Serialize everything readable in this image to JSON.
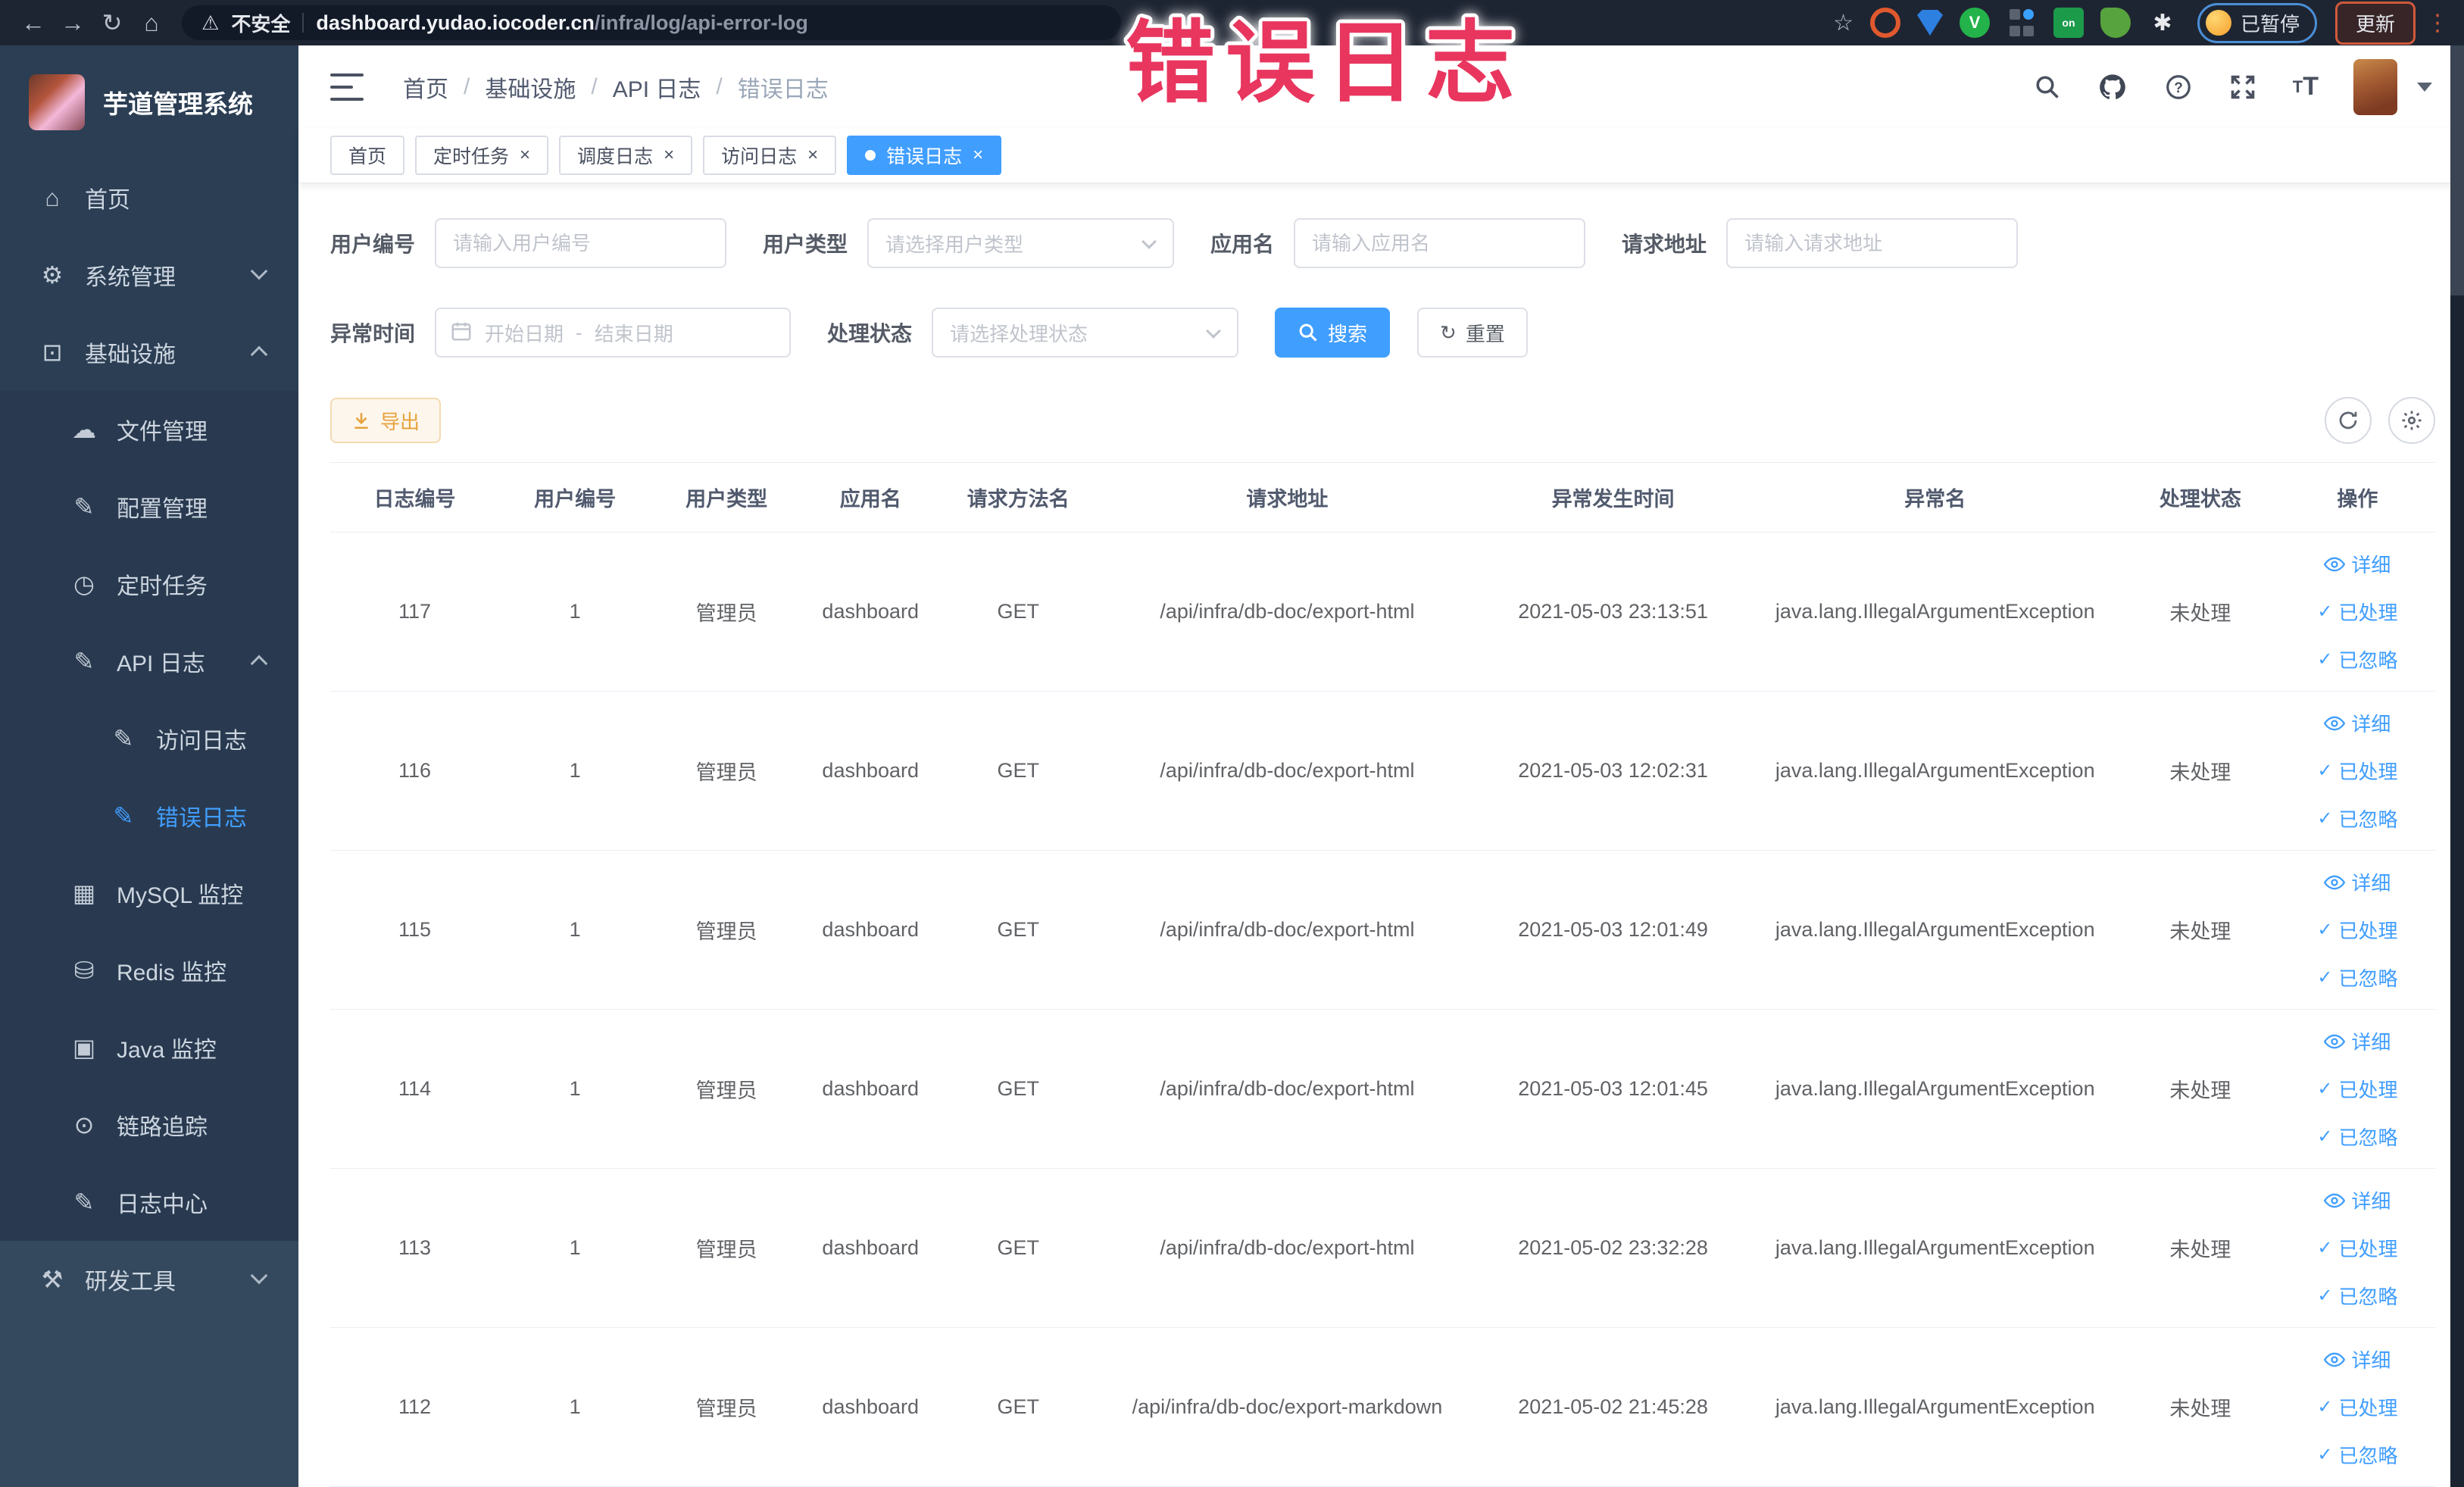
{
  "colors": {
    "accent": "#409EFF",
    "warning": "#E6A23C",
    "overlay_red": "#E8365F"
  },
  "overlay_title": "错误日志",
  "browser": {
    "security": "不安全",
    "url_domain": "dashboard.yudao.iocoder.cn",
    "url_path": "/infra/log/api-error-log",
    "paused": "已暂停",
    "update": "更新"
  },
  "glyphs": {
    "back": "←",
    "forward": "→",
    "reload": "↻",
    "home": "⌂",
    "warning": "⚠",
    "star": "☆",
    "puzzle": "✱",
    "onoff": "on",
    "dots": "⋮",
    "check": "✓",
    "question": "?",
    "font_t_big": "T",
    "font_t_small": "T",
    "mi_home": "⌂",
    "mi_system": "⚙",
    "mi_infra": "⊡",
    "mi_file": "☁",
    "mi_config": "✎",
    "mi_job": "◷",
    "mi_api": "✎",
    "mi_access": "✎",
    "mi_error": "✎",
    "mi_mysql": "▦",
    "mi_redis": "⛁",
    "mi_java": "▣",
    "mi_trace": "⊙",
    "mi_logcenter": "✎",
    "mi_dev": "⚒",
    "close": "×"
  },
  "sidebar": {
    "title": "芋道管理系统",
    "home": "首页",
    "system": "系统管理",
    "infra": "基础设施",
    "file": "文件管理",
    "config": "配置管理",
    "job": "定时任务",
    "api_log": "API 日志",
    "access_log": "访问日志",
    "error_log": "错误日志",
    "mysql": "MySQL 监控",
    "redis": "Redis 监控",
    "java": "Java 监控",
    "trace": "链路追踪",
    "log_center": "日志中心",
    "dev": "研发工具"
  },
  "breadcrumb": {
    "sep": "/",
    "items": [
      "首页",
      "基础设施",
      "API 日志",
      "错误日志"
    ]
  },
  "tabs": [
    {
      "label": "首页"
    },
    {
      "label": "定时任务"
    },
    {
      "label": "调度日志"
    },
    {
      "label": "访问日志"
    },
    {
      "label": "错误日志"
    }
  ],
  "filters": {
    "user_id_label": "用户编号",
    "user_id_placeholder": "请输入用户编号",
    "user_type_label": "用户类型",
    "user_type_placeholder": "请选择用户类型",
    "app_label": "应用名",
    "app_placeholder": "请输入应用名",
    "url_label": "请求地址",
    "url_placeholder": "请输入请求地址",
    "time_label": "异常时间",
    "time_start_placeholder": "开始日期",
    "time_separator": "-",
    "time_end_placeholder": "结束日期",
    "status_label": "处理状态",
    "status_placeholder": "请选择处理状态",
    "search": "搜索",
    "reset": "重置"
  },
  "toolbar": {
    "export": "导出"
  },
  "table": {
    "columns": [
      "日志编号",
      "用户编号",
      "用户类型",
      "应用名",
      "请求方法名",
      "请求地址",
      "异常发生时间",
      "异常名",
      "处理状态",
      "操作"
    ],
    "ops": {
      "detail": "详细",
      "processed": "已处理",
      "ignored": "已忽略"
    },
    "rows": [
      {
        "id": "117",
        "user_id": "1",
        "user_type": "管理员",
        "app": "dashboard",
        "method": "GET",
        "url": "/api/infra/db-doc/export-html",
        "time": "2021-05-03 23:13:51",
        "exception": "java.lang.IllegalArgumentException",
        "status": "未处理"
      },
      {
        "id": "116",
        "user_id": "1",
        "user_type": "管理员",
        "app": "dashboard",
        "method": "GET",
        "url": "/api/infra/db-doc/export-html",
        "time": "2021-05-03 12:02:31",
        "exception": "java.lang.IllegalArgumentException",
        "status": "未处理"
      },
      {
        "id": "115",
        "user_id": "1",
        "user_type": "管理员",
        "app": "dashboard",
        "method": "GET",
        "url": "/api/infra/db-doc/export-html",
        "time": "2021-05-03 12:01:49",
        "exception": "java.lang.IllegalArgumentException",
        "status": "未处理"
      },
      {
        "id": "114",
        "user_id": "1",
        "user_type": "管理员",
        "app": "dashboard",
        "method": "GET",
        "url": "/api/infra/db-doc/export-html",
        "time": "2021-05-03 12:01:45",
        "exception": "java.lang.IllegalArgumentException",
        "status": "未处理"
      },
      {
        "id": "113",
        "user_id": "1",
        "user_type": "管理员",
        "app": "dashboard",
        "method": "GET",
        "url": "/api/infra/db-doc/export-html",
        "time": "2021-05-02 23:32:28",
        "exception": "java.lang.IllegalArgumentException",
        "status": "未处理"
      },
      {
        "id": "112",
        "user_id": "1",
        "user_type": "管理员",
        "app": "dashboard",
        "method": "GET",
        "url": "/api/infra/db-doc/export-markdown",
        "time": "2021-05-02 21:45:28",
        "exception": "java.lang.IllegalArgumentException",
        "status": "未处理"
      }
    ]
  }
}
